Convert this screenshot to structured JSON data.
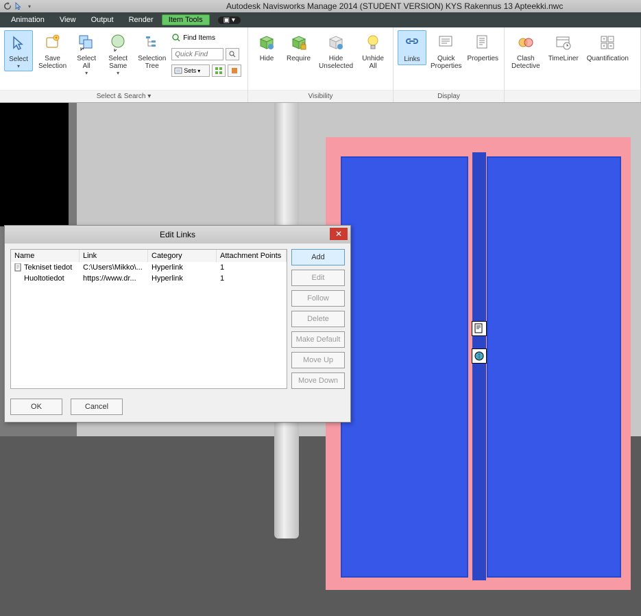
{
  "app": {
    "title": "Autodesk Navisworks Manage 2014 (STUDENT VERSION)    KYS Rakennus 13 Apteekki.nwc"
  },
  "menu": {
    "items": [
      "Animation",
      "View",
      "Output",
      "Render",
      "Item Tools"
    ],
    "active": "Item Tools",
    "plus": "▣ ▾"
  },
  "ribbon": {
    "panel1_title": "Select & Search ▾",
    "select": "Select",
    "save_selection": "Save\nSelection",
    "select_all": "Select\nAll",
    "select_same": "Select\nSame",
    "selection_tree": "Selection\nTree",
    "find_items": "Find Items",
    "quick_find_placeholder": "Quick Find",
    "sets": "Sets",
    "panel2_title": "Visibility",
    "hide": "Hide",
    "require": "Require",
    "hide_unselected": "Hide\nUnselected",
    "unhide_all": "Unhide\nAll",
    "panel3_title": "Display",
    "links": "Links",
    "quick_properties": "Quick\nProperties",
    "properties": "Properties",
    "clash_detective": "Clash\nDetective",
    "timeliner": "TimeLiner",
    "quantification": "Quantification"
  },
  "dialog": {
    "title": "Edit Links",
    "headers": {
      "name": "Name",
      "link": "Link",
      "category": "Category",
      "attachment": "Attachment Points"
    },
    "rows": [
      {
        "name": "Tekniset tiedot",
        "link": "C:\\Users\\Mikko\\...",
        "category": "Hyperlink",
        "attachment": "1"
      },
      {
        "name": "Huoltotiedot",
        "link": "https://www.dr...",
        "category": "Hyperlink",
        "attachment": "1"
      }
    ],
    "buttons": {
      "add": "Add",
      "edit": "Edit",
      "follow": "Follow",
      "delete": "Delete",
      "make_default": "Make Default",
      "move_up": "Move Up",
      "move_down": "Move Down",
      "ok": "OK",
      "cancel": "Cancel"
    }
  }
}
